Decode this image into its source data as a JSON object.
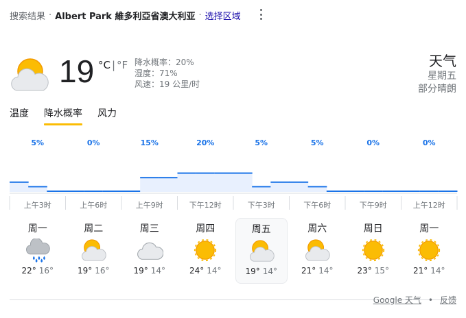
{
  "header": {
    "crumb": "搜索结果",
    "location": "Albert Park 維多利亞省澳大利亚",
    "select_region": "选择区域"
  },
  "current": {
    "icon": "partly-cloudy-icon",
    "temp": "19",
    "unit_c": "°C",
    "unit_sep": "|",
    "unit_f": "°F",
    "precip": "降水概率：20%",
    "humidity": "湿度：71%",
    "wind": "风速：19 公里/时"
  },
  "right": {
    "title": "天气",
    "day": "星期五",
    "condition": "部分晴朗"
  },
  "tabs": [
    {
      "label": "温度",
      "active": false
    },
    {
      "label": "降水概率",
      "active": true
    },
    {
      "label": "风力",
      "active": false
    }
  ],
  "chart_data": {
    "type": "bar",
    "categories": [
      "上午3时",
      "上午6时",
      "上午9时",
      "下午12时",
      "下午3时",
      "下午6时",
      "下午9时",
      "上午12时"
    ],
    "labels": [
      "5%",
      "0%",
      "15%",
      "20%",
      "5%",
      "5%",
      "0%",
      "0%"
    ],
    "values": [
      5,
      0,
      15,
      20,
      5,
      5,
      0,
      0
    ],
    "step_values": [
      10,
      5,
      0,
      0,
      0,
      0,
      0,
      15,
      15,
      20,
      20,
      20,
      20,
      5,
      10,
      10,
      5,
      0,
      0,
      0,
      0,
      0,
      0,
      0
    ],
    "ylim": [
      0,
      100
    ],
    "color": "#1a73e8",
    "label_color": "#1a73e8"
  },
  "days": [
    {
      "name": "周一",
      "icon": "rain-cloud-icon",
      "hi": "22°",
      "lo": "16°",
      "selected": false
    },
    {
      "name": "周二",
      "icon": "partly-cloudy-icon",
      "hi": "19°",
      "lo": "16°",
      "selected": false
    },
    {
      "name": "周三",
      "icon": "cloud-icon",
      "hi": "19°",
      "lo": "14°",
      "selected": false
    },
    {
      "name": "周四",
      "icon": "sun-icon",
      "hi": "24°",
      "lo": "14°",
      "selected": false
    },
    {
      "name": "周五",
      "icon": "partly-cloudy-icon",
      "hi": "19°",
      "lo": "14°",
      "selected": true
    },
    {
      "name": "周六",
      "icon": "partly-cloudy-icon",
      "hi": "21°",
      "lo": "14°",
      "selected": false
    },
    {
      "name": "周日",
      "icon": "sun-icon",
      "hi": "23°",
      "lo": "15°",
      "selected": false
    },
    {
      "name": "周一",
      "icon": "sun-icon",
      "hi": "21°",
      "lo": "14°",
      "selected": false
    }
  ],
  "footer": {
    "source": "Google 天气",
    "bullet": "•",
    "feedback": "反馈"
  },
  "colors": {
    "sun": "#fbbc04",
    "sun_edge": "#f29900",
    "cloud": "#e8eaed",
    "rain": "#1a73e8",
    "accent": "#1a0dab"
  }
}
